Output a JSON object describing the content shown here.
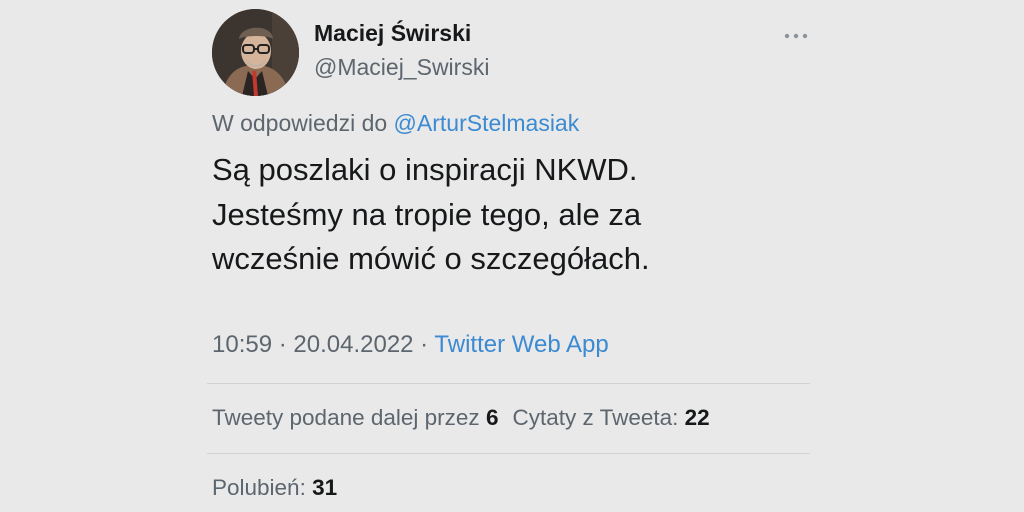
{
  "author": {
    "display_name": "Maciej Świrski",
    "handle": "@Maciej_Swirski"
  },
  "reply": {
    "prefix": "W odpowiedzi do ",
    "mention": "@ArturStelmasiak"
  },
  "tweet": {
    "text_lines": [
      "Są poszlaki o inspiracji NKWD.",
      "Jesteśmy na tropie tego, ale za",
      "wcześnie mówić o szczegółach."
    ]
  },
  "meta": {
    "time": "10:59",
    "separator_1": " · ",
    "date": "20.04.2022",
    "separator_2": " · ",
    "source": "Twitter Web App"
  },
  "stats": {
    "retweets_label": "Tweety podane dalej przez ",
    "retweets_count": "6",
    "quotes_label": "Cytaty z Tweeta: ",
    "quotes_count": "22",
    "likes_label": "Polubień: ",
    "likes_count": "31"
  },
  "icons": {
    "more": "more-horizontal-icon"
  },
  "colors": {
    "background": "#e9e9e9",
    "link": "#3b8ad2",
    "secondary_text": "#5d666e",
    "primary_text": "#16181a"
  }
}
